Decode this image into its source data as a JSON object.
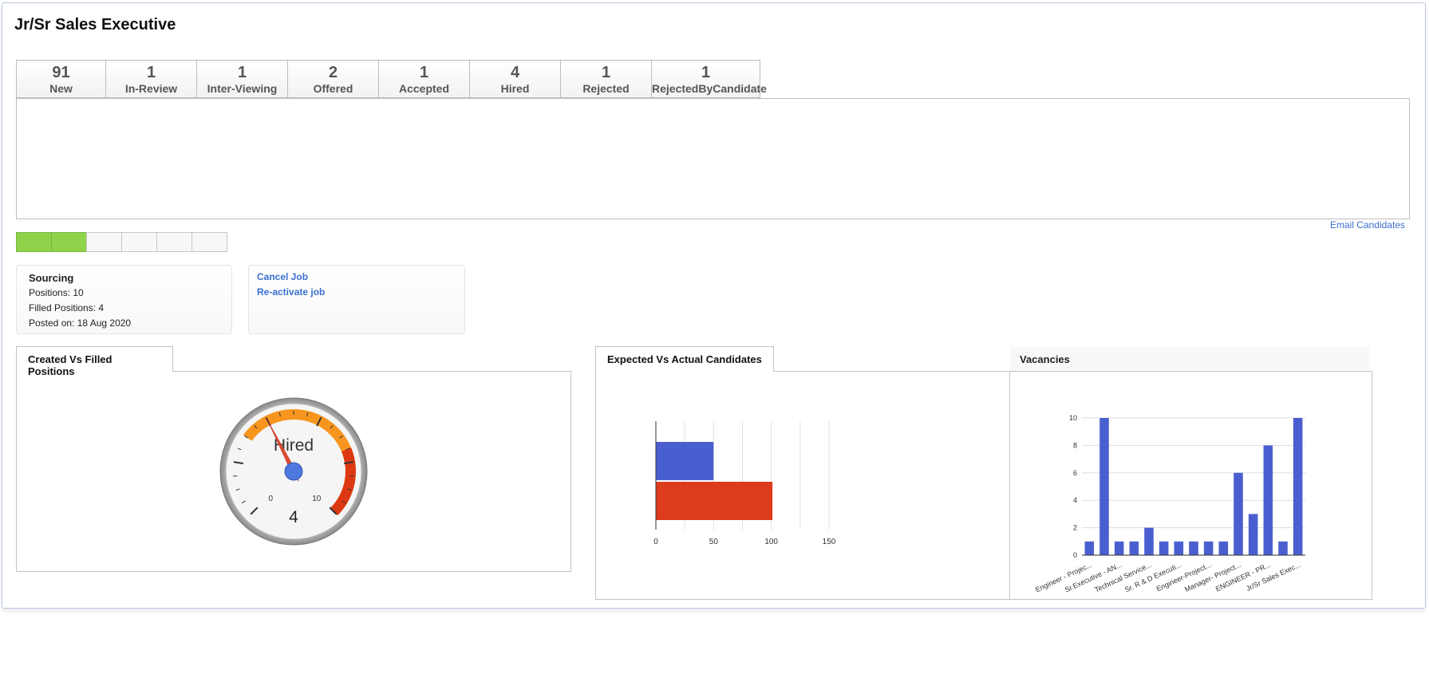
{
  "page": {
    "title": "Jr/Sr Sales Executive"
  },
  "stages": [
    {
      "count": "91",
      "label": "New"
    },
    {
      "count": "1",
      "label": "In-Review"
    },
    {
      "count": "1",
      "label": "Inter-Viewing"
    },
    {
      "count": "2",
      "label": "Offered"
    },
    {
      "count": "1",
      "label": "Accepted"
    },
    {
      "count": "4",
      "label": "Hired"
    },
    {
      "count": "1",
      "label": "Rejected"
    },
    {
      "count": "1",
      "label": "RejectedByCandidate"
    }
  ],
  "email_link": "Email Candidates",
  "progress": {
    "total_steps": 6,
    "completed_steps": 2,
    "colors": {
      "done": "#8fd34a",
      "pending": "#f7f7f7"
    }
  },
  "status": {
    "title": "Sourcing",
    "positions": "Positions: 10",
    "filled": "Filled Positions: 4",
    "posted": "Posted on: 18 Aug 2020"
  },
  "actions": {
    "cancel": "Cancel Job",
    "reactivate": "Re-activate job"
  },
  "tabs": {
    "created_vs_filled": "Created Vs Filled Positions",
    "expected_vs_actual": "Expected Vs Actual Candidates",
    "vacancies": "Vacancies"
  },
  "chart_data": [
    {
      "type": "gauge",
      "label": "Hired",
      "value": 4,
      "min": 0,
      "max": 10,
      "min_label": "0",
      "max_label": "10",
      "bands": [
        {
          "from": 0,
          "to": 10,
          "color": "#f5f5f5"
        },
        {
          "from": 3,
          "to": 10,
          "color": "#f7951e"
        },
        {
          "from": 7.5,
          "to": 10,
          "color": "#dc3912"
        }
      ],
      "value_label": "4"
    },
    {
      "type": "bar",
      "orientation": "horizontal",
      "series": [
        {
          "values": [
            50
          ],
          "color": "#4a5fcf"
        },
        {
          "values": [
            101
          ],
          "color": "#dc3b1c"
        }
      ],
      "xlim": [
        0,
        150
      ],
      "xticks": [
        "0",
        "50",
        "100",
        "150"
      ],
      "grid": true
    },
    {
      "type": "bar",
      "categories": [
        "Engineer - Projec...",
        "",
        "Sr.Executive - AN...",
        "",
        "Technical Service...",
        "",
        "Sr. R & D Executi...",
        "",
        "Engineer-Project...",
        "",
        "Manager- Project...",
        "",
        "ENGINEER - PR...",
        "",
        "Jr/Sr Sales Exec..."
      ],
      "values": [
        1,
        10,
        1,
        1,
        2,
        1,
        1,
        1,
        1,
        1,
        6,
        3,
        8,
        1,
        10
      ],
      "ylim": [
        0,
        10
      ],
      "yticks": [
        "0",
        "2",
        "4",
        "6",
        "8",
        "10"
      ],
      "color": "#4a5fcf",
      "grid": true
    }
  ]
}
